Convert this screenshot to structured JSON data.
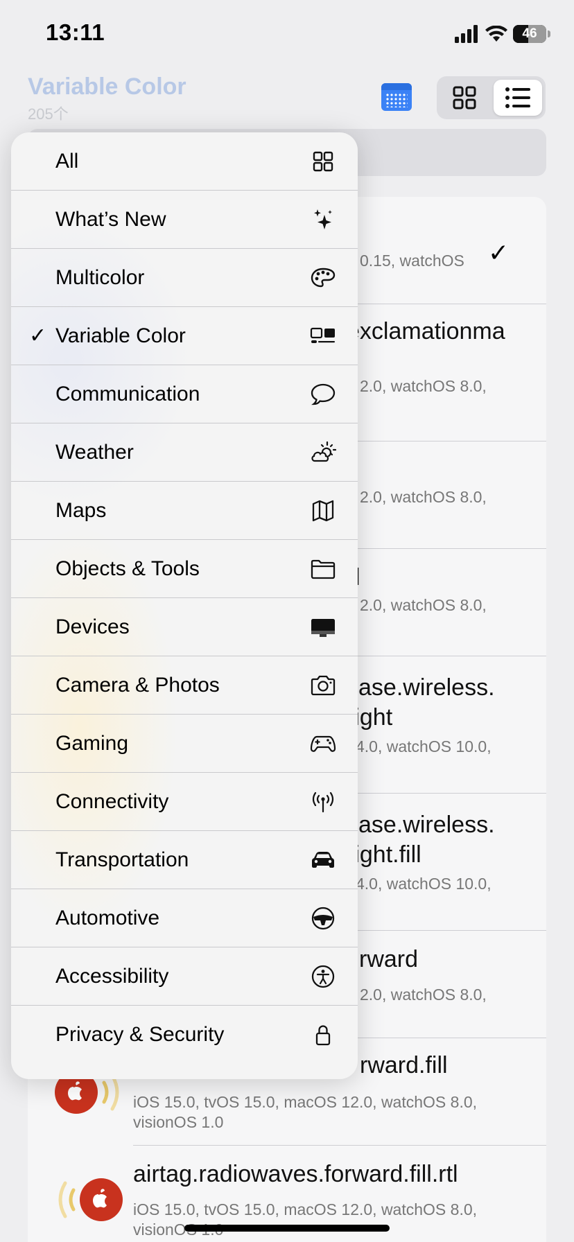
{
  "status_bar": {
    "time": "13:11",
    "battery_level": "46",
    "battery_fraction": 0.46
  },
  "header": {
    "title": "Variable Color",
    "count": "205个"
  },
  "menu": {
    "items": [
      {
        "label": "All",
        "icon": "grid-icon",
        "checked": false
      },
      {
        "label": "What’s New",
        "icon": "sparkles-icon",
        "checked": false
      },
      {
        "label": "Multicolor",
        "icon": "paintpalette-icon",
        "checked": false
      },
      {
        "label": "Variable Color",
        "icon": "variable-color-icon",
        "checked": true,
        "check": "✓"
      },
      {
        "label": "Communication",
        "icon": "message-bubble-icon",
        "checked": false
      },
      {
        "label": "Weather",
        "icon": "cloud-sun-icon",
        "checked": false
      },
      {
        "label": "Maps",
        "icon": "map-icon",
        "checked": false
      },
      {
        "label": "Objects & Tools",
        "icon": "folder-icon",
        "checked": false
      },
      {
        "label": "Devices",
        "icon": "desktop-computer-icon",
        "checked": false
      },
      {
        "label": "Camera & Photos",
        "icon": "camera-icon",
        "checked": false
      },
      {
        "label": "Gaming",
        "icon": "gamecontroller-icon",
        "checked": false
      },
      {
        "label": "Connectivity",
        "icon": "antenna-radiowaves-icon",
        "checked": false
      },
      {
        "label": "Transportation",
        "icon": "car-icon",
        "checked": false
      },
      {
        "label": "Automotive",
        "icon": "steering-wheel-icon",
        "checked": false
      },
      {
        "label": "Accessibility",
        "icon": "accessibility-icon",
        "checked": false
      },
      {
        "label": "Privacy & Security",
        "icon": "lock-icon",
        "checked": false
      }
    ]
  },
  "list": {
    "rows": [
      {
        "name": "",
        "platforms": [
          "0.15, watchOS"
        ],
        "check": "✓"
      },
      {
        "name": "exclamationma",
        "platforms": [
          "2.0, watchOS 8.0,"
        ]
      },
      {
        "name": "",
        "platforms": [
          "2.0, watchOS 8.0,"
        ]
      },
      {
        "name": "l",
        "platforms": [
          "2.0, watchOS 8.0,"
        ]
      },
      {
        "name": "case.wireless.",
        "name2": "right",
        "platforms": [
          "4.0, watchOS 10.0,"
        ]
      },
      {
        "name": "case.wireless.",
        "name2": "right.fill",
        "platforms": [
          "4.0, watchOS 10.0,"
        ]
      },
      {
        "name": "rward",
        "platforms": [
          "2.0, watchOS 8.0,"
        ]
      },
      {
        "name": "rward.fill",
        "platforms": [
          "iOS 15.0, tvOS 15.0, macOS 12.0, watchOS 8.0,",
          "visionOS 1.0"
        ]
      },
      {
        "name": "airtag.radiowaves.forward.fill.rtl",
        "platforms": [
          "iOS 15.0, tvOS 15.0, macOS 12.0, watchOS 8.0,",
          "visionOS 1.0"
        ]
      }
    ]
  },
  "colors": {
    "accent": "#3b82f6",
    "airtag_red": "#c8321e",
    "wave_yellow": "#e8c96a"
  }
}
